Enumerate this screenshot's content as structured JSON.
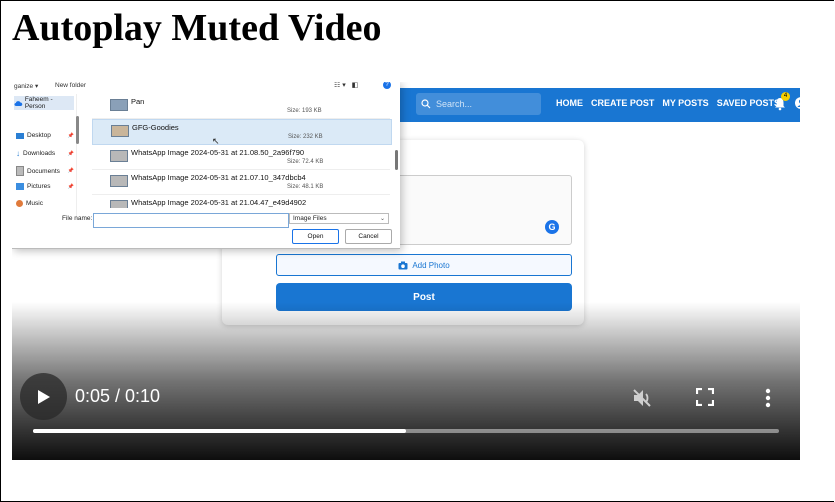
{
  "page": {
    "title": "Autoplay Muted Video"
  },
  "app": {
    "search_placeholder": "Search...",
    "nav": [
      "HOME",
      "CREATE POST",
      "MY POSTS",
      "SAVED POSTS"
    ],
    "notification_count": "4",
    "add_photo_label": "Add Photo",
    "post_label": "Post",
    "grammar_icon_letter": "G"
  },
  "dialog": {
    "toolbar": {
      "organize": "ganize ▾",
      "new_folder": "New folder"
    },
    "quick_access": {
      "home": "Faheem - Person",
      "items": [
        "Desktop",
        "Downloads",
        "Documents",
        "Pictures",
        "Music"
      ]
    },
    "files": [
      {
        "name": "Pan",
        "size": "Size: 193 KB",
        "selected": false
      },
      {
        "name": "GFG-Goodies",
        "size": "Size: 232 KB",
        "selected": true
      },
      {
        "name": "WhatsApp Image 2024-05-31 at 21.08.50_2a96f790",
        "size": "Size: 72.4 KB",
        "selected": false
      },
      {
        "name": "WhatsApp Image 2024-05-31 at 21.07.10_347dbcb4",
        "size": "Size: 48.1 KB",
        "selected": false
      },
      {
        "name": "WhatsApp Image 2024-05-31 at 21.04.47_e49d4902",
        "size": "",
        "selected": false
      }
    ],
    "file_name_label": "File name:",
    "file_name_value": "",
    "file_type": "Image Files",
    "open_label": "Open",
    "cancel_label": "Cancel"
  },
  "video": {
    "time": "0:05 / 0:10",
    "progress": 0.5,
    "muted": true,
    "colors": {
      "nav": "#1976d2",
      "control": "#ffffff"
    }
  }
}
